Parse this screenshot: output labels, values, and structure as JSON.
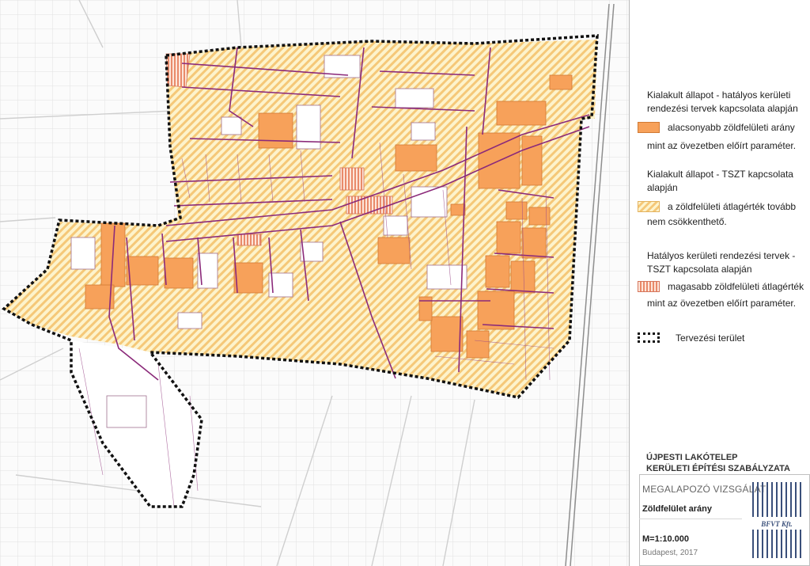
{
  "legend": {
    "group1_title": "Kialakult állapot - hatályos kerületi rendezési tervek kapcsolata alapján",
    "item1_label": "alacsonyabb zöldfelületi arány",
    "item1_cont": "mint az övezetben előírt paraméter.",
    "group2_title": "Kialakult állapot - TSZT kapcsolata alapján",
    "item2_label": "a zöldfelületi átlagérték tovább",
    "item2_cont": "nem csökkenthető.",
    "group3_title": "Hatályos kerületi rendezési tervek - TSZT kapcsolata alapján",
    "item3_label": "magasabb zöldfelületi átlagérték",
    "item3_cont": "mint az övezetben előírt paraméter.",
    "item4_label": "Tervezési terület"
  },
  "title_block": {
    "project_line1": "ÚJPESTI LAKÓTELEP",
    "project_line2": "KERÜLETI ÉPÍTÉSI SZABÁLYZATA",
    "subtitle": "MEGALAPOZÓ VIZSGÁLAT",
    "sheet_title": "Zöldfelület arány",
    "scale": "M=1:10.000",
    "place_year": "Budapest, 2017",
    "logo_text": "BFVT Kft."
  },
  "colors": {
    "orange": "#f7a15a",
    "hatch_yellow": "#f5c878",
    "red_hatch": "#e98a6a",
    "purple_lines": "#8b2a7a",
    "boundary": "#111111"
  },
  "icons": [
    "orange-swatch-icon",
    "hatched-swatch-icon",
    "red-striped-swatch-icon",
    "dashed-boundary-icon",
    "bfvt-logo-icon"
  ]
}
